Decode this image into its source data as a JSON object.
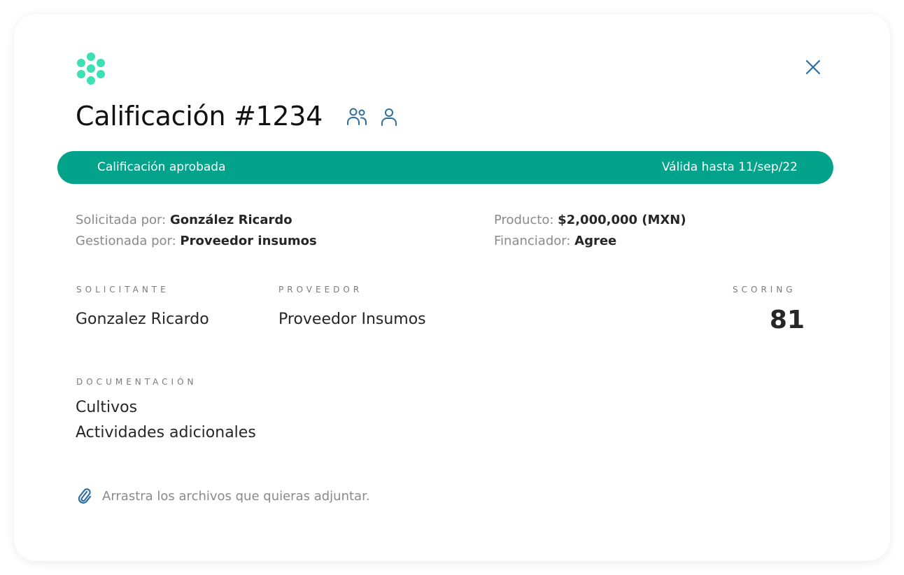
{
  "header": {
    "title": "Calificación #1234",
    "icons": [
      "users-icon",
      "user-icon"
    ],
    "close_icon": "close-icon"
  },
  "status": {
    "label": "Calificación aprobada",
    "validity": "Válida hasta 11/sep/22",
    "color": "#02a38a"
  },
  "meta": {
    "requested_by_label": "Solicitada por:",
    "requested_by_value": "González Ricardo",
    "managed_by_label": "Gestionada por:",
    "managed_by_value": "Proveedor insumos",
    "product_label": "Producto:",
    "product_value": "$2,000,000 (MXN)",
    "financer_label": "Financiador:",
    "financer_value": "Agree"
  },
  "summary": {
    "applicant_label": "Solicitante",
    "applicant_value": "Gonzalez Ricardo",
    "provider_label": "Proveedor",
    "provider_value": "Proveedor Insumos",
    "scoring_label": "Scoring",
    "scoring_value": "81"
  },
  "documentation": {
    "label": "Documentación",
    "items": [
      "Cultivos",
      "Actividades adicionales"
    ]
  },
  "attachments": {
    "icon": "paperclip-icon",
    "text": "Arrastra los archivos que quieras adjuntar."
  },
  "colors": {
    "brand": "#3de0b4",
    "accent": "#02a38a",
    "icon_blue": "#2e6e9e"
  }
}
